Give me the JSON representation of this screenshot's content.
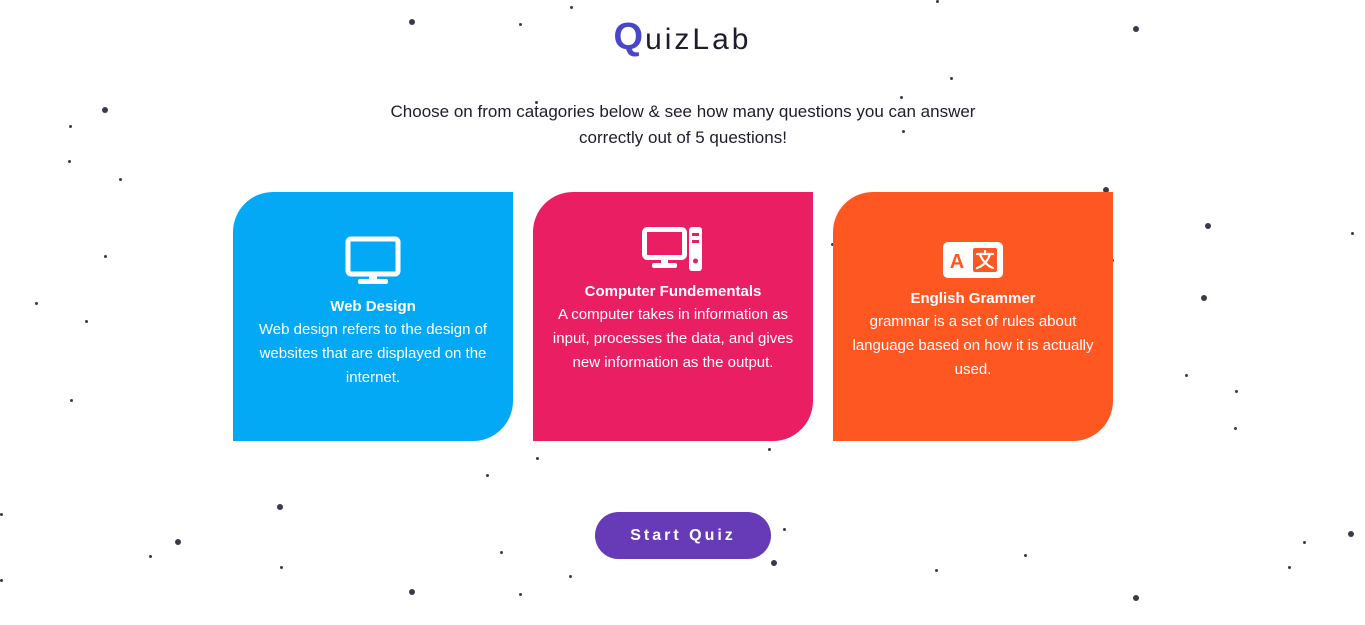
{
  "header": {
    "logo_first_letter": "Q",
    "logo_rest": "uizLab",
    "intro_text": "Choose on from catagories below & see how many questions you can answer correctly out of 5 questions!"
  },
  "colors": {
    "brand": "#4a46c9",
    "web_card": "#03a9f4",
    "computer_card": "#e91e63",
    "english_card": "#ff5722",
    "button": "#673ab7"
  },
  "categories": [
    {
      "icon": "monitor-icon",
      "title": "Web Design",
      "description": "Web design refers to the design of websites that are displayed on the internet."
    },
    {
      "icon": "desktop-computer-icon",
      "title": "Computer Fundementals",
      "description": "A computer takes in information as input, processes the data, and gives new information as the output."
    },
    {
      "icon": "translate-icon",
      "title": "English Grammer",
      "description": "grammar is a set of rules about language based on how it is actually used."
    }
  ],
  "start_button": {
    "label": "Start Quiz"
  }
}
